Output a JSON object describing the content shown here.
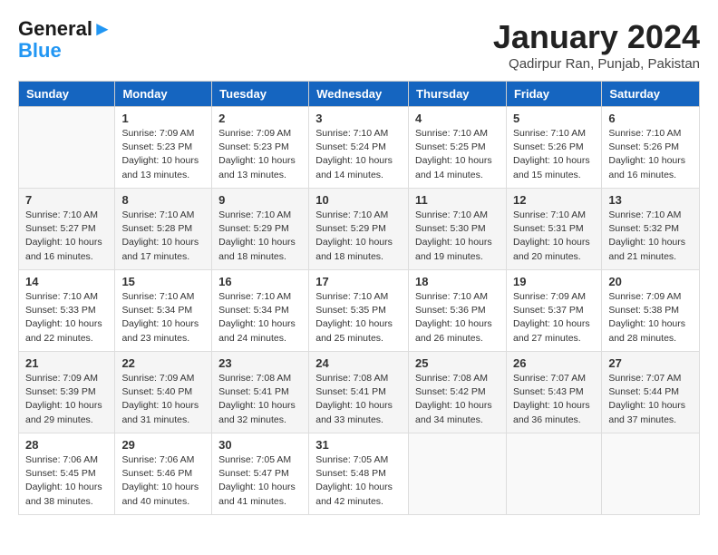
{
  "header": {
    "logo_line1": "General",
    "logo_line2": "Blue",
    "title": "January 2024",
    "subtitle": "Qadirpur Ran, Punjab, Pakistan"
  },
  "days_of_week": [
    "Sunday",
    "Monday",
    "Tuesday",
    "Wednesday",
    "Thursday",
    "Friday",
    "Saturday"
  ],
  "weeks": [
    [
      {
        "day": "",
        "sunrise": "",
        "sunset": "",
        "daylight": ""
      },
      {
        "day": "1",
        "sunrise": "Sunrise: 7:09 AM",
        "sunset": "Sunset: 5:23 PM",
        "daylight": "Daylight: 10 hours and 13 minutes."
      },
      {
        "day": "2",
        "sunrise": "Sunrise: 7:09 AM",
        "sunset": "Sunset: 5:23 PM",
        "daylight": "Daylight: 10 hours and 13 minutes."
      },
      {
        "day": "3",
        "sunrise": "Sunrise: 7:10 AM",
        "sunset": "Sunset: 5:24 PM",
        "daylight": "Daylight: 10 hours and 14 minutes."
      },
      {
        "day": "4",
        "sunrise": "Sunrise: 7:10 AM",
        "sunset": "Sunset: 5:25 PM",
        "daylight": "Daylight: 10 hours and 14 minutes."
      },
      {
        "day": "5",
        "sunrise": "Sunrise: 7:10 AM",
        "sunset": "Sunset: 5:26 PM",
        "daylight": "Daylight: 10 hours and 15 minutes."
      },
      {
        "day": "6",
        "sunrise": "Sunrise: 7:10 AM",
        "sunset": "Sunset: 5:26 PM",
        "daylight": "Daylight: 10 hours and 16 minutes."
      }
    ],
    [
      {
        "day": "7",
        "sunrise": "Sunrise: 7:10 AM",
        "sunset": "Sunset: 5:27 PM",
        "daylight": "Daylight: 10 hours and 16 minutes."
      },
      {
        "day": "8",
        "sunrise": "Sunrise: 7:10 AM",
        "sunset": "Sunset: 5:28 PM",
        "daylight": "Daylight: 10 hours and 17 minutes."
      },
      {
        "day": "9",
        "sunrise": "Sunrise: 7:10 AM",
        "sunset": "Sunset: 5:29 PM",
        "daylight": "Daylight: 10 hours and 18 minutes."
      },
      {
        "day": "10",
        "sunrise": "Sunrise: 7:10 AM",
        "sunset": "Sunset: 5:29 PM",
        "daylight": "Daylight: 10 hours and 18 minutes."
      },
      {
        "day": "11",
        "sunrise": "Sunrise: 7:10 AM",
        "sunset": "Sunset: 5:30 PM",
        "daylight": "Daylight: 10 hours and 19 minutes."
      },
      {
        "day": "12",
        "sunrise": "Sunrise: 7:10 AM",
        "sunset": "Sunset: 5:31 PM",
        "daylight": "Daylight: 10 hours and 20 minutes."
      },
      {
        "day": "13",
        "sunrise": "Sunrise: 7:10 AM",
        "sunset": "Sunset: 5:32 PM",
        "daylight": "Daylight: 10 hours and 21 minutes."
      }
    ],
    [
      {
        "day": "14",
        "sunrise": "Sunrise: 7:10 AM",
        "sunset": "Sunset: 5:33 PM",
        "daylight": "Daylight: 10 hours and 22 minutes."
      },
      {
        "day": "15",
        "sunrise": "Sunrise: 7:10 AM",
        "sunset": "Sunset: 5:34 PM",
        "daylight": "Daylight: 10 hours and 23 minutes."
      },
      {
        "day": "16",
        "sunrise": "Sunrise: 7:10 AM",
        "sunset": "Sunset: 5:34 PM",
        "daylight": "Daylight: 10 hours and 24 minutes."
      },
      {
        "day": "17",
        "sunrise": "Sunrise: 7:10 AM",
        "sunset": "Sunset: 5:35 PM",
        "daylight": "Daylight: 10 hours and 25 minutes."
      },
      {
        "day": "18",
        "sunrise": "Sunrise: 7:10 AM",
        "sunset": "Sunset: 5:36 PM",
        "daylight": "Daylight: 10 hours and 26 minutes."
      },
      {
        "day": "19",
        "sunrise": "Sunrise: 7:09 AM",
        "sunset": "Sunset: 5:37 PM",
        "daylight": "Daylight: 10 hours and 27 minutes."
      },
      {
        "day": "20",
        "sunrise": "Sunrise: 7:09 AM",
        "sunset": "Sunset: 5:38 PM",
        "daylight": "Daylight: 10 hours and 28 minutes."
      }
    ],
    [
      {
        "day": "21",
        "sunrise": "Sunrise: 7:09 AM",
        "sunset": "Sunset: 5:39 PM",
        "daylight": "Daylight: 10 hours and 29 minutes."
      },
      {
        "day": "22",
        "sunrise": "Sunrise: 7:09 AM",
        "sunset": "Sunset: 5:40 PM",
        "daylight": "Daylight: 10 hours and 31 minutes."
      },
      {
        "day": "23",
        "sunrise": "Sunrise: 7:08 AM",
        "sunset": "Sunset: 5:41 PM",
        "daylight": "Daylight: 10 hours and 32 minutes."
      },
      {
        "day": "24",
        "sunrise": "Sunrise: 7:08 AM",
        "sunset": "Sunset: 5:41 PM",
        "daylight": "Daylight: 10 hours and 33 minutes."
      },
      {
        "day": "25",
        "sunrise": "Sunrise: 7:08 AM",
        "sunset": "Sunset: 5:42 PM",
        "daylight": "Daylight: 10 hours and 34 minutes."
      },
      {
        "day": "26",
        "sunrise": "Sunrise: 7:07 AM",
        "sunset": "Sunset: 5:43 PM",
        "daylight": "Daylight: 10 hours and 36 minutes."
      },
      {
        "day": "27",
        "sunrise": "Sunrise: 7:07 AM",
        "sunset": "Sunset: 5:44 PM",
        "daylight": "Daylight: 10 hours and 37 minutes."
      }
    ],
    [
      {
        "day": "28",
        "sunrise": "Sunrise: 7:06 AM",
        "sunset": "Sunset: 5:45 PM",
        "daylight": "Daylight: 10 hours and 38 minutes."
      },
      {
        "day": "29",
        "sunrise": "Sunrise: 7:06 AM",
        "sunset": "Sunset: 5:46 PM",
        "daylight": "Daylight: 10 hours and 40 minutes."
      },
      {
        "day": "30",
        "sunrise": "Sunrise: 7:05 AM",
        "sunset": "Sunset: 5:47 PM",
        "daylight": "Daylight: 10 hours and 41 minutes."
      },
      {
        "day": "31",
        "sunrise": "Sunrise: 7:05 AM",
        "sunset": "Sunset: 5:48 PM",
        "daylight": "Daylight: 10 hours and 42 minutes."
      },
      {
        "day": "",
        "sunrise": "",
        "sunset": "",
        "daylight": ""
      },
      {
        "day": "",
        "sunrise": "",
        "sunset": "",
        "daylight": ""
      },
      {
        "day": "",
        "sunrise": "",
        "sunset": "",
        "daylight": ""
      }
    ]
  ]
}
